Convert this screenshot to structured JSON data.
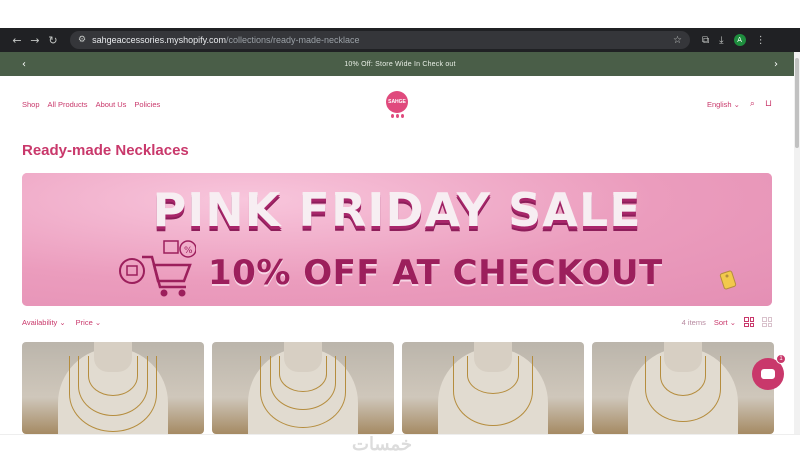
{
  "browser": {
    "url_host": "sahgeaccessories.myshopify.com",
    "url_path": "/collections/ready-made-necklace",
    "profile_initial": "A"
  },
  "announcement": {
    "message": "10% Off: Store Wide In Check out"
  },
  "nav": {
    "items": [
      "Shop",
      "All Products",
      "About Us",
      "Policies"
    ],
    "logo_text": "SAHGE",
    "language": "English"
  },
  "page": {
    "title": "Ready-made Necklaces"
  },
  "banner": {
    "line1": "PINK FRIDAY SALE",
    "line2": "10% OFF AT CHECKOUT"
  },
  "filters": {
    "availability": "Availability",
    "price": "Price",
    "count": "4 items",
    "sort": "Sort"
  },
  "chat": {
    "badge": "1"
  },
  "watermark": "خمسات",
  "colors": {
    "brand_pink": "#c9386b",
    "announcement_bg": "#4a5e48",
    "banner_bg": "#eea3c2"
  }
}
